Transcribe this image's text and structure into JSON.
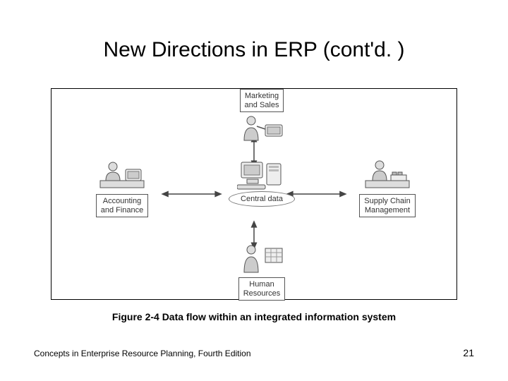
{
  "title": "New Directions in ERP (cont'd. )",
  "diagram": {
    "center_label": "Central data",
    "nodes": {
      "top": {
        "label": "Marketing\nand Sales"
      },
      "left": {
        "label": "Accounting\nand Finance"
      },
      "right": {
        "label": "Supply Chain\nManagement"
      },
      "bottom": {
        "label": "Human\nResources"
      }
    }
  },
  "caption": "Figure 2-4  Data flow within an integrated information system",
  "footer_left": "Concepts in Enterprise Resource Planning, Fourth Edition",
  "page_number": "21"
}
